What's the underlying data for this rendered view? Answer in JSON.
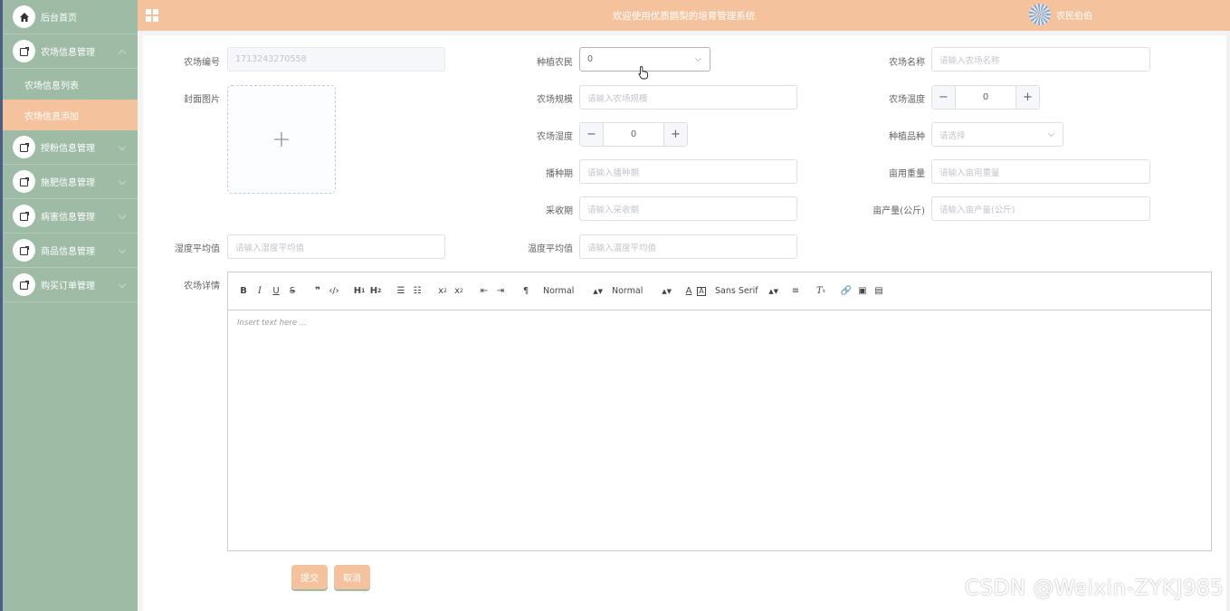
{
  "header": {
    "title": "欢迎使用优质鹅梨的培育管理系统",
    "user_name": "农民伯伯"
  },
  "sidebar": {
    "items": [
      {
        "label": "后台首页",
        "icon": "home-icon"
      },
      {
        "label": "农场信息管理",
        "icon": "edit-icon",
        "expanded": true,
        "children": [
          {
            "label": "农场信息列表",
            "active": false
          },
          {
            "label": "农场信息添加",
            "active": true
          }
        ]
      },
      {
        "label": "授粉信息管理",
        "icon": "edit-icon"
      },
      {
        "label": "施肥信息管理",
        "icon": "edit-icon"
      },
      {
        "label": "病害信息管理",
        "icon": "edit-icon"
      },
      {
        "label": "商品信息管理",
        "icon": "edit-icon"
      },
      {
        "label": "购买订单管理",
        "icon": "edit-icon"
      }
    ]
  },
  "form": {
    "farm_no": {
      "label": "农场编号",
      "value": "1713243270558"
    },
    "farmer": {
      "label": "种植农民",
      "value": "0"
    },
    "farm_name": {
      "label": "农场名称",
      "placeholder": "请输入农场名称"
    },
    "cover": {
      "label": "封面图片"
    },
    "farm_scale": {
      "label": "农场规模",
      "placeholder": "请输入农场规模"
    },
    "farm_temp": {
      "label": "农场温度",
      "value": "0"
    },
    "farm_humidity": {
      "label": "农场湿度",
      "value": "0"
    },
    "variety": {
      "label": "种植品种",
      "placeholder": "请选择"
    },
    "sowing": {
      "label": "播种期",
      "placeholder": "请输入播种期"
    },
    "fert_amount": {
      "label": "亩用重量",
      "placeholder": "请输入亩用重量"
    },
    "harvest": {
      "label": "采收期",
      "placeholder": "请输入采收期"
    },
    "yield": {
      "label": "亩产量(公斤)",
      "placeholder": "请输入亩产量(公斤)"
    },
    "humidity_avg": {
      "label": "湿度平均值",
      "placeholder": "请输入湿度平均值"
    },
    "temp_avg": {
      "label": "温度平均值",
      "placeholder": "请输入温度平均值"
    },
    "detail": {
      "label": "农场详情",
      "editor_placeholder": "Insert text here ..."
    }
  },
  "editor_toolbar": {
    "header_picker": "Normal",
    "size_picker": "Normal",
    "font_picker": "Sans Serif"
  },
  "buttons": {
    "submit": "提交",
    "cancel": "取消"
  },
  "watermark": "CSDN @Weixin-ZYKJ985"
}
